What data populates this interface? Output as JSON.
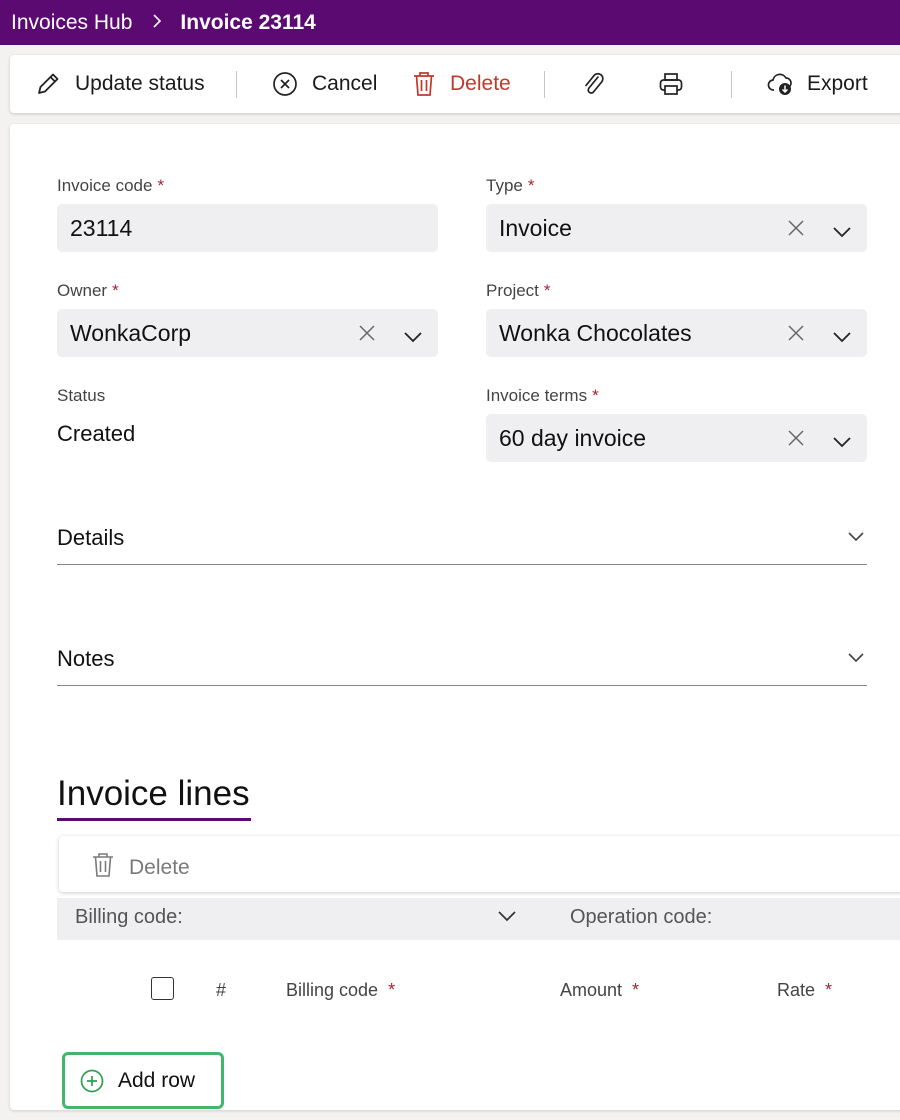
{
  "breadcrumb": {
    "root": "Invoices Hub",
    "separator": ">",
    "current": "Invoice 23114"
  },
  "toolbar": {
    "update_status": "Update status",
    "cancel": "Cancel",
    "delete": "Delete",
    "export": "Export"
  },
  "form": {
    "invoice_code": {
      "label": "Invoice code",
      "required": "*",
      "value": "23114"
    },
    "type": {
      "label": "Type",
      "required": "*",
      "value": "Invoice"
    },
    "owner": {
      "label": "Owner",
      "required": "*",
      "value": "WonkaCorp"
    },
    "project": {
      "label": "Project",
      "required": "*",
      "value": "Wonka Chocolates"
    },
    "status": {
      "label": "Status",
      "value": "Created"
    },
    "invoice_terms": {
      "label": "Invoice terms",
      "required": "*",
      "value": "60 day invoice"
    }
  },
  "sections": {
    "details": "Details",
    "notes": "Notes"
  },
  "invoice_lines": {
    "title": "Invoice lines",
    "delete_label": "Delete",
    "filters": {
      "billing_code": "Billing code:",
      "operation_code": "Operation code:"
    },
    "columns": {
      "number": "#",
      "billing_code": "Billing code",
      "amount": "Amount",
      "rate": "Rate",
      "required": "*"
    },
    "add_row": "Add row"
  },
  "colors": {
    "brand": "#5b0a72",
    "danger": "#c0392b",
    "add_row_border": "#44b66b",
    "required": "#a4262c"
  },
  "icons": [
    "pencil-icon",
    "cancel-circle-icon",
    "trash-icon",
    "paperclip-icon",
    "print-icon",
    "cloud-download-icon",
    "close-icon",
    "chevron-down-icon",
    "plus-circle-icon"
  ]
}
